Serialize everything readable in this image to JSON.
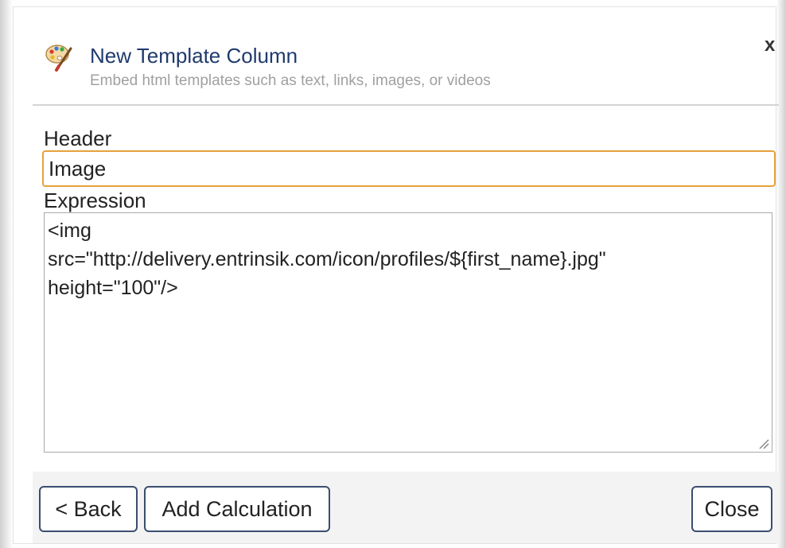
{
  "dialog": {
    "title": "New Template Column",
    "subtitle": "Embed html templates such as text, links, images, or videos",
    "close_symbol": "x",
    "icon": "paint-palette-icon"
  },
  "form": {
    "header_label": "Header",
    "header_value": "Image",
    "expression_label": "Expression",
    "expression_value": "<img\nsrc=\"http://delivery.entrinsik.com/icon/profiles/${first_name}.jpg\"\nheight=\"100\"/>"
  },
  "footer": {
    "back_label": "< Back",
    "add_calculation_label": "Add Calculation",
    "close_label": "Close"
  },
  "colors": {
    "title": "#1f3a6e",
    "subtitle": "#a0a0a0",
    "focus_border": "#e6a23c",
    "button_border": "#3a4e6e",
    "footer_bg": "#f3f3f3"
  }
}
